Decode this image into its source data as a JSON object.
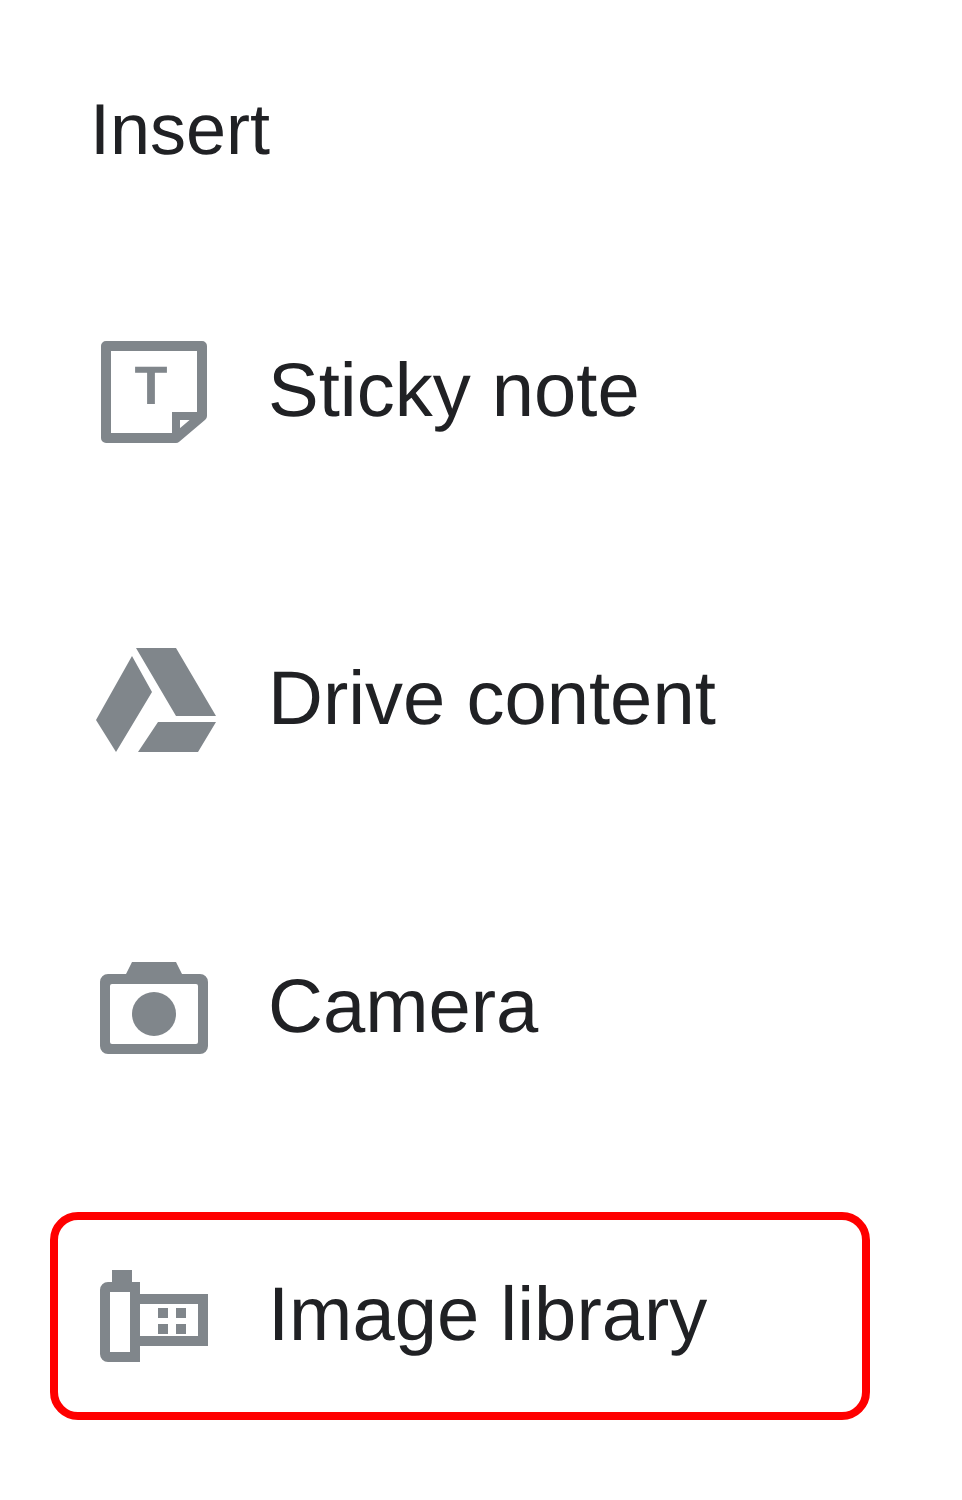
{
  "title": "Insert",
  "items": [
    {
      "kind": "note",
      "icon_glyph": "T",
      "label": "Sticky note",
      "highlighted": false
    },
    {
      "kind": "drive",
      "label": "Drive content",
      "highlighted": false
    },
    {
      "kind": "camera",
      "label": "Camera",
      "highlighted": false
    },
    {
      "kind": "library",
      "label": "Image library",
      "highlighted": true
    }
  ]
}
